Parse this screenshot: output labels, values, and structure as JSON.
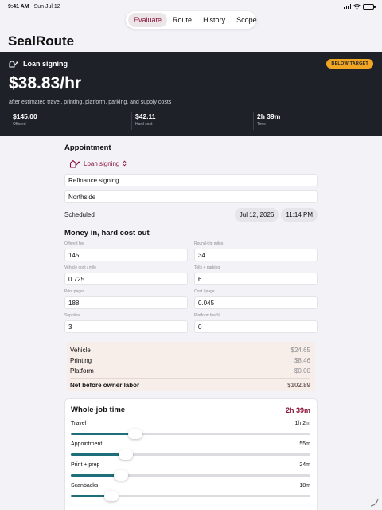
{
  "status": {
    "time": "9:41 AM",
    "date": "Sun Jul 12"
  },
  "tabs": [
    {
      "label": "Evaluate",
      "active": true
    },
    {
      "label": "Route",
      "active": false
    },
    {
      "label": "History",
      "active": false
    },
    {
      "label": "Scope",
      "active": false
    }
  ],
  "app": {
    "title": "SealRoute"
  },
  "hero": {
    "job_type": "Loan signing",
    "badge": "BELOW TARGET",
    "rate": "$38.83/hr",
    "subtitle": "after estimated travel, printing, platform, parking, and supply costs",
    "stats": [
      {
        "value": "$145.00",
        "label": "Offered"
      },
      {
        "value": "$42.11",
        "label": "Hard cost"
      },
      {
        "value": "2h 39m",
        "label": "Time"
      }
    ]
  },
  "appointment": {
    "heading": "Appointment",
    "type_label": "Loan signing",
    "fields": [
      "Refinance signing",
      "Northside"
    ],
    "scheduled_label": "Scheduled",
    "date": "Jul 12, 2026",
    "time": "11:14 PM"
  },
  "money": {
    "heading": "Money in, hard cost out",
    "fields": [
      {
        "label": "Offered fee",
        "value": "145"
      },
      {
        "label": "Round-trip miles",
        "value": "34"
      },
      {
        "label": "Vehicle cost / mile",
        "value": "0.725"
      },
      {
        "label": "Tolls + parking",
        "value": "6"
      },
      {
        "label": "Print pages",
        "value": "188"
      },
      {
        "label": "Cost / page",
        "value": "0.045"
      },
      {
        "label": "Supplies",
        "value": "3"
      },
      {
        "label": "Platform fee %",
        "value": "0"
      }
    ]
  },
  "costs": {
    "rows": [
      {
        "label": "Vehicle",
        "value": "$24.65"
      },
      {
        "label": "Printing",
        "value": "$8.46"
      },
      {
        "label": "Platform",
        "value": "$0.00"
      }
    ],
    "total": {
      "label": "Net before owner labor",
      "value": "$102.89"
    }
  },
  "timing": {
    "heading": "Whole-job time",
    "total": "2h 39m",
    "items": [
      {
        "label": "Travel",
        "value": "1h 2m",
        "fraction": 0.27
      },
      {
        "label": "Appointment",
        "value": "55m",
        "fraction": 0.23
      },
      {
        "label": "Print + prep",
        "value": "24m",
        "fraction": 0.21
      },
      {
        "label": "Scanbacks",
        "value": "18m",
        "fraction": 0.17
      }
    ]
  },
  "colors": {
    "accent": "#8a1238",
    "hero_bg": "#1e2228",
    "badge": "#f0a523",
    "slider": "#1f6f7a"
  }
}
